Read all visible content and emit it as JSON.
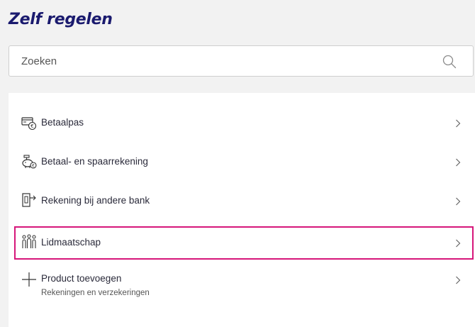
{
  "page": {
    "title": "Zelf regelen"
  },
  "search": {
    "placeholder": "Zoeken",
    "icon": "search-icon"
  },
  "menu": {
    "items": [
      {
        "label": "Betaalpas",
        "icon": "debit-card-icon"
      },
      {
        "label": "Betaal- en spaarrekening",
        "icon": "piggy-bank-icon"
      },
      {
        "label": "Rekening bij andere bank",
        "icon": "door-exit-icon"
      },
      {
        "label": "Lidmaatschap",
        "icon": "members-group-icon",
        "highlighted": true
      },
      {
        "label": "Product toevoegen",
        "sublabel": "Rekeningen en verzekeringen",
        "icon": "plus-icon"
      }
    ]
  },
  "colors": {
    "title": "#1a1a6e",
    "highlight_border": "#d6167a",
    "background": "#f2f2f2",
    "panel": "#ffffff"
  }
}
